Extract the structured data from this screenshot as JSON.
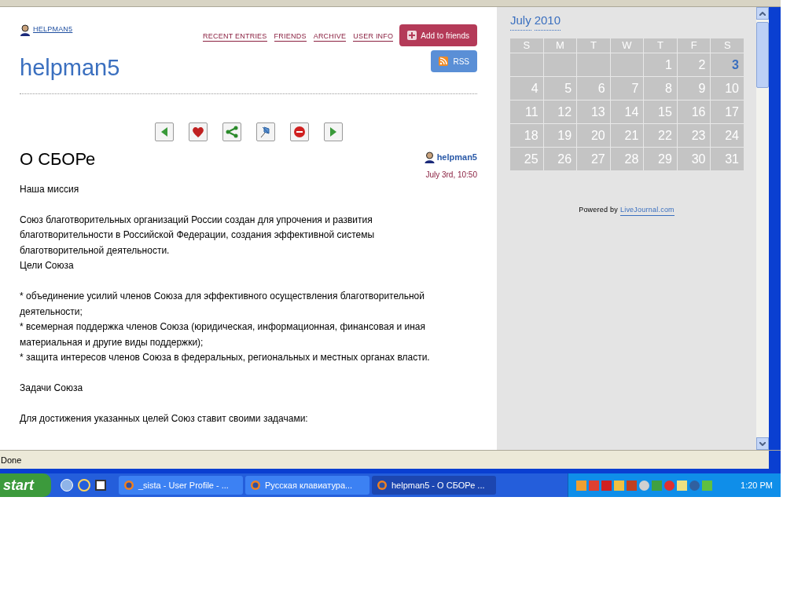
{
  "header": {
    "user_link": "HELPMAN5",
    "nav": [
      "RECENT ENTRIES",
      "FRIENDS",
      "ARCHIVE",
      "USER INFO"
    ],
    "add_friends": "Add to friends",
    "rss": "RSS",
    "title": "helpman5"
  },
  "toolbar": [
    {
      "kind": "previous"
    },
    {
      "kind": "heart"
    },
    {
      "kind": "share"
    },
    {
      "kind": "pin"
    },
    {
      "kind": "stop"
    },
    {
      "kind": "next"
    }
  ],
  "entry": {
    "title": "О СБОРе",
    "author": "helpman5",
    "date": "July 3rd, 10:50",
    "blocks": [
      [
        "Наша миссия"
      ],
      [
        "Союз благотворительных организаций России создан для упрочения и развития благотворительности в Российской Федерации, создания эффективной системы благотворительной деятельности.",
        "Цели Союза"
      ],
      [
        "* объединение усилий членов Союза для эффективного осуществления благотворительной деятельности;",
        "* всемерная поддержка членов Союза (юридическая, информационная, финансовая и иная материальная и другие виды поддержки);",
        "* защита интересов членов Союза в федеральных, региональных и местных органах власти."
      ],
      [
        "Задачи Союза"
      ],
      [
        "Для достижения указанных целей Союз ставит своими задачами:"
      ]
    ]
  },
  "calendar": {
    "month": "July",
    "year": "2010",
    "weekdays": [
      "S",
      "M",
      "T",
      "W",
      "T",
      "F",
      "S"
    ],
    "weeks": [
      [
        {
          "kind": "blank"
        },
        {
          "kind": "blank"
        },
        {
          "kind": "blank"
        },
        {
          "kind": "blank"
        },
        {
          "day": "1",
          "has_entry": false
        },
        {
          "day": "2",
          "has_entry": false
        },
        {
          "day": "3",
          "has_entry": true
        }
      ],
      [
        {
          "day": "4",
          "has_entry": false
        },
        {
          "day": "5",
          "has_entry": false
        },
        {
          "day": "6",
          "has_entry": false
        },
        {
          "day": "7",
          "has_entry": false
        },
        {
          "day": "8",
          "has_entry": false
        },
        {
          "day": "9",
          "has_entry": false
        },
        {
          "day": "10",
          "has_entry": false
        }
      ],
      [
        {
          "day": "11",
          "has_entry": false
        },
        {
          "day": "12",
          "has_entry": false
        },
        {
          "day": "13",
          "has_entry": false
        },
        {
          "day": "14",
          "has_entry": false
        },
        {
          "day": "15",
          "has_entry": false
        },
        {
          "day": "16",
          "has_entry": false
        },
        {
          "day": "17",
          "has_entry": false
        }
      ],
      [
        {
          "day": "18",
          "has_entry": false
        },
        {
          "day": "19",
          "has_entry": false
        },
        {
          "day": "20",
          "has_entry": false
        },
        {
          "day": "21",
          "has_entry": false
        },
        {
          "day": "22",
          "has_entry": false
        },
        {
          "day": "23",
          "has_entry": false
        },
        {
          "day": "24",
          "has_entry": false
        }
      ],
      [
        {
          "day": "25",
          "has_entry": false
        },
        {
          "day": "26",
          "has_entry": false
        },
        {
          "day": "27",
          "has_entry": false
        },
        {
          "day": "28",
          "has_entry": false
        },
        {
          "day": "29",
          "has_entry": false
        },
        {
          "day": "30",
          "has_entry": false
        },
        {
          "day": "31",
          "has_entry": false
        }
      ]
    ],
    "powered_prefix": "Powered by",
    "powered_link": "LiveJournal.com"
  },
  "status_bar": "Done",
  "taskbar": {
    "start": "start",
    "windows": [
      {
        "label": "_sista - User Profile - ...",
        "selected": false
      },
      {
        "label": "Русская клавиатура...",
        "selected": false
      },
      {
        "label": "helpman5 - О СБОРе ...",
        "selected": true
      }
    ],
    "clock": "1:20 PM"
  }
}
